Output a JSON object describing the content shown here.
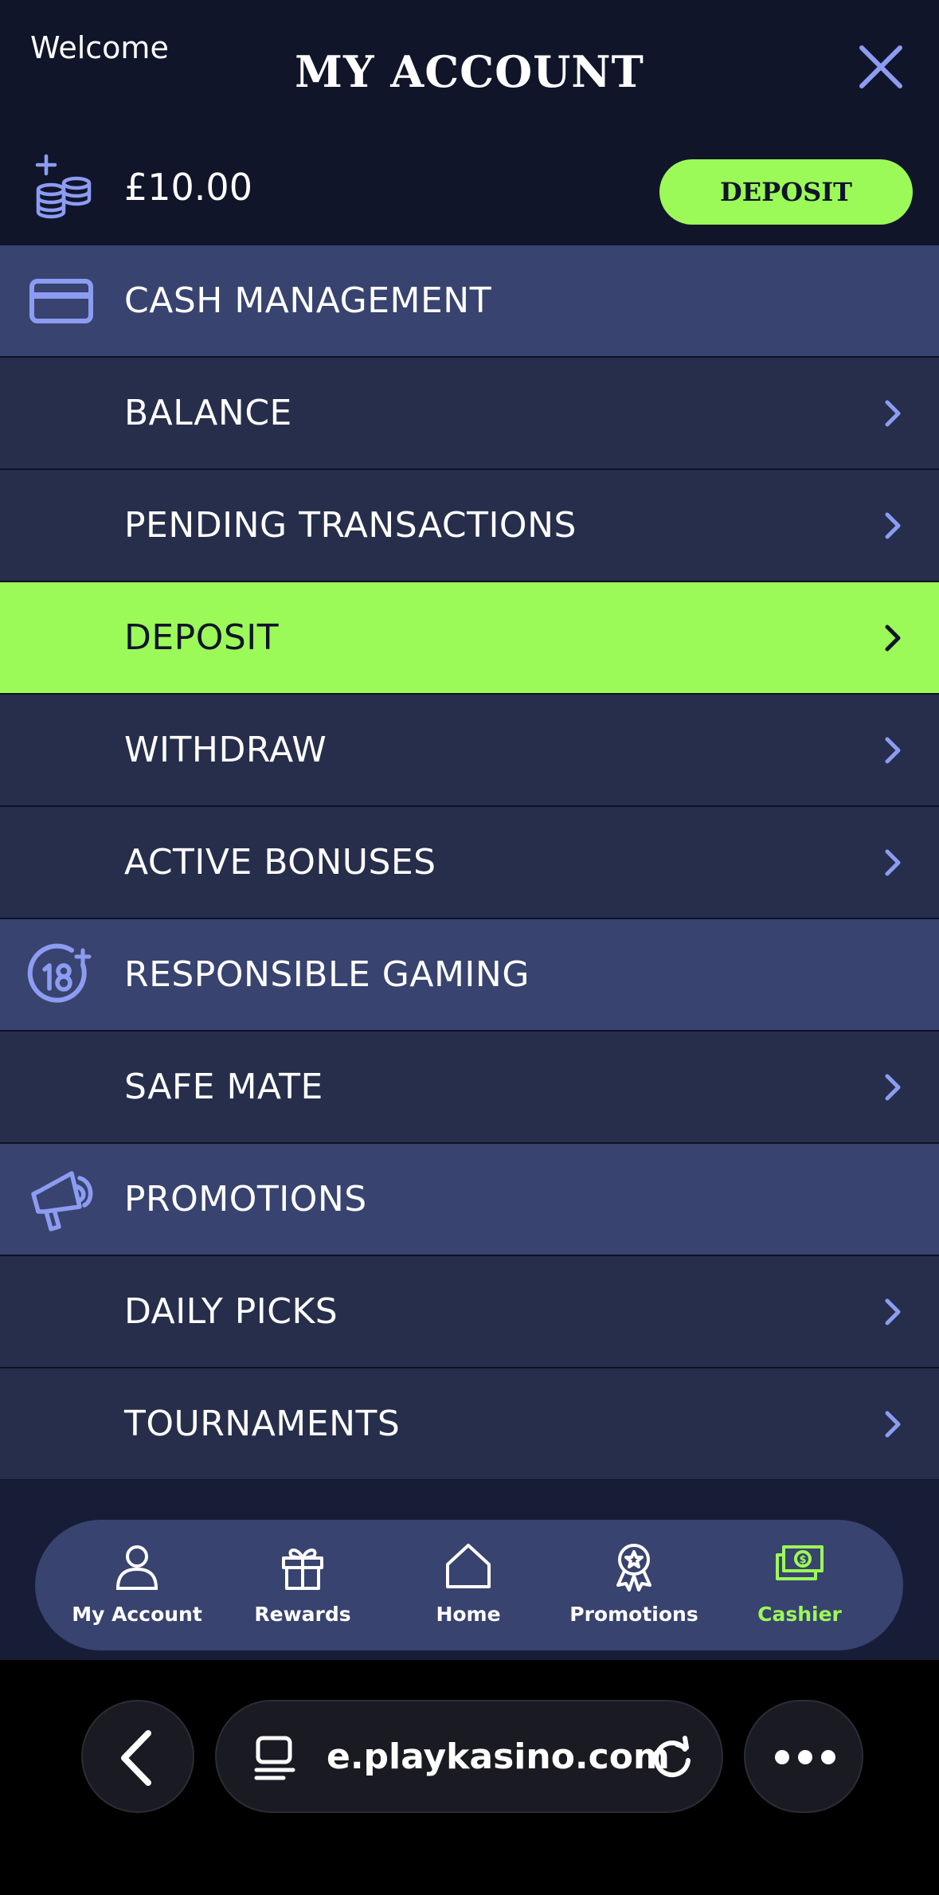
{
  "header": {
    "welcome": "Welcome",
    "title": "MY ACCOUNT",
    "close_icon": "close-icon",
    "balance": "£10.00",
    "deposit_label": "DEPOSIT"
  },
  "colors": {
    "background": "#11152a",
    "section": "#38436f",
    "item": "#262e4b",
    "accent": "#9cfa58",
    "icon": "#8c9cf2"
  },
  "menu": {
    "cash_management": "CASH MANAGEMENT",
    "balance": "BALANCE",
    "pending_transactions": "PENDING TRANSACTIONS",
    "deposit": "DEPOSIT",
    "withdraw": "WITHDRAW",
    "active_bonuses": "ACTIVE BONUSES",
    "responsible_gaming": "RESPONSIBLE GAMING",
    "safe_mate": "SAFE MATE",
    "promotions": "PROMOTIONS",
    "daily_picks": "DAILY PICKS",
    "tournaments": "TOURNAMENTS"
  },
  "tabbar": {
    "my_account": "My Account",
    "rewards": "Rewards",
    "home": "Home",
    "promotions": "Promotions",
    "cashier": "Cashier",
    "selected": "Cashier"
  },
  "browser": {
    "url": "e.playkasino.com"
  }
}
